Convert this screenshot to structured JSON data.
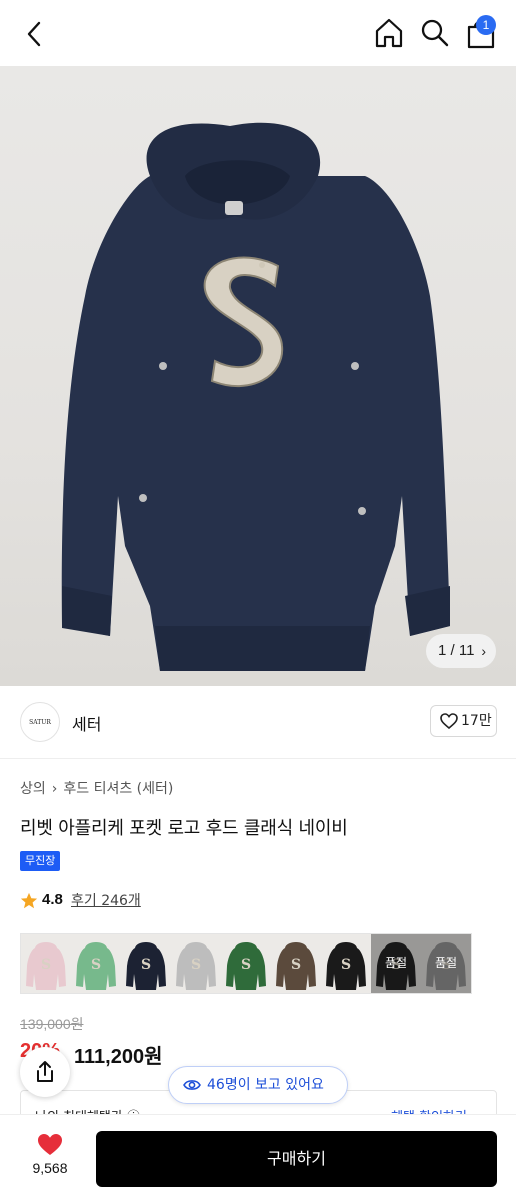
{
  "header": {
    "cart_count": "1",
    "icons": [
      "back-arrow-icon",
      "home-icon",
      "search-icon",
      "cart-icon"
    ]
  },
  "hero": {
    "image_counter": "1 / 11"
  },
  "brand": {
    "logo_text": "SATUR",
    "name": "세터",
    "likes": "17만"
  },
  "breadcrumb": [
    "상의",
    "후드 티셔츠 (세터)"
  ],
  "product": {
    "title": "리벳 아플리케 포켓 로고 후드 클래식 네이비",
    "badge": "무진장",
    "rating": "4.8",
    "reviews": "후기 246개"
  },
  "swatches": [
    {
      "color": "#e8c9cf",
      "sold_out": false
    },
    {
      "color": "#77b98c",
      "sold_out": false
    },
    {
      "color": "#1c2233",
      "sold_out": false,
      "selected": true
    },
    {
      "color": "#bdbdbd",
      "sold_out": false
    },
    {
      "color": "#2f6b3a",
      "sold_out": false
    },
    {
      "color": "#5b4a3c",
      "sold_out": false
    },
    {
      "color": "#1a1a1a",
      "sold_out": false
    },
    {
      "color": "#252525",
      "sold_out": true,
      "label": "품절"
    },
    {
      "color": "#9c9c9c",
      "sold_out": true,
      "label": "품절"
    }
  ],
  "price": {
    "original": "139,000원",
    "discount": "20%",
    "sale": "111,200원"
  },
  "viewers": "46명이 보고 있어요",
  "benefit": {
    "left": "나의 최대혜택가 ⓘ",
    "right": "혜택 확인하기 ⌄"
  },
  "bottom": {
    "fav_count": "9,568",
    "buy_label": "구매하기"
  },
  "colors": {
    "accent_blue": "#1d5cf5",
    "sale_red": "#e53030",
    "heart_red": "#e62e3a",
    "hoodie_navy": "#25304a"
  }
}
